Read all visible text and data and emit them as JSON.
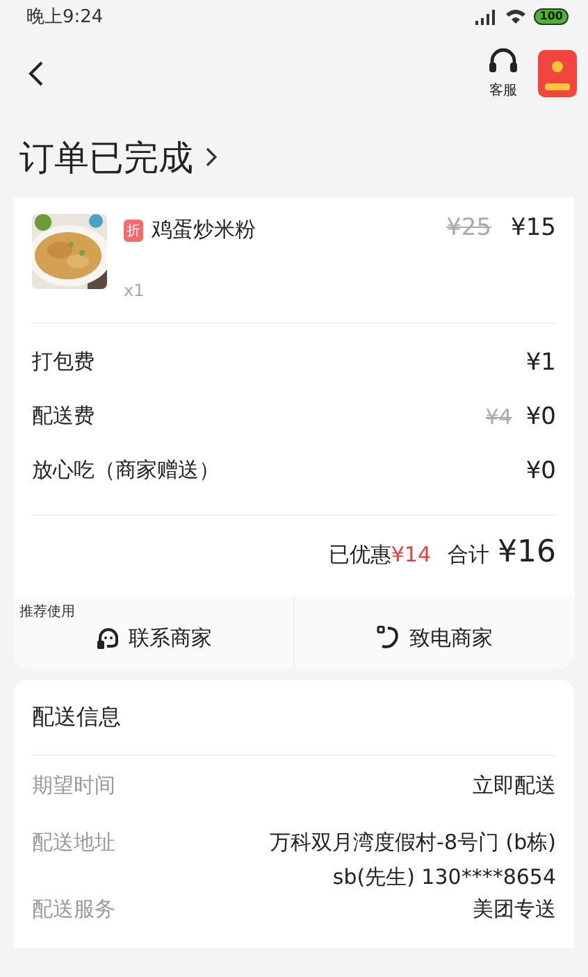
{
  "status_bar": {
    "time": "晚上9:24",
    "battery": "100"
  },
  "nav": {
    "service_label": "客服"
  },
  "title": "订单已完成",
  "order": {
    "items": [
      {
        "name": "鸡蛋炒米粉",
        "discount_tag": "折",
        "original_price": "¥25",
        "price": "¥15",
        "quantity": "x1",
        "kind": "picture"
      }
    ],
    "fees": [
      {
        "label": "打包费",
        "price": "¥1"
      },
      {
        "label": "配送费",
        "original_price": "¥4",
        "price": "¥0"
      },
      {
        "label": "放心吃（商家赠送）",
        "price": "¥0"
      }
    ],
    "saved_label": "已优惠",
    "saved_amount": "¥14",
    "total_label": "合计",
    "total": "¥16",
    "actions": [
      {
        "label": "联系商家",
        "kind": "chat",
        "badge": "推荐使用"
      },
      {
        "label": "致电商家",
        "kind": "phone"
      }
    ]
  },
  "delivery": {
    "title": "配送信息",
    "rows": [
      {
        "label": "期望时间",
        "values": [
          "立即配送"
        ]
      },
      {
        "label": "配送地址",
        "values": [
          "万科双月湾度假村-8号门 (b栋)",
          "sb(先生) 130****8654"
        ]
      },
      {
        "label": "配送服务",
        "values": [
          "美团专送"
        ]
      }
    ]
  }
}
